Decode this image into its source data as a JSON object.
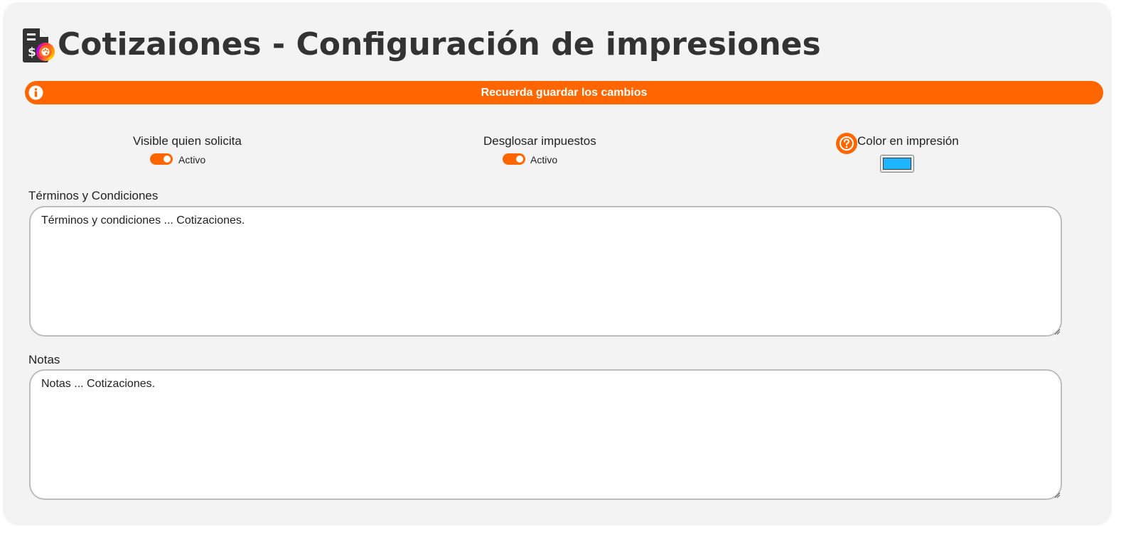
{
  "page": {
    "title": "Cotizaiones - Configuración de impresiones",
    "title_icon": "document-dollar-palette-icon"
  },
  "banner": {
    "text": "Recuerda guardar los cambios",
    "icon": "info-icon",
    "color": "#ff6600"
  },
  "options": {
    "visible_quien_solicita": {
      "label": "Visible quien solicita",
      "state": "Activo",
      "enabled": true
    },
    "desglosar_impuestos": {
      "label": "Desglosar impuestos",
      "state": "Activo",
      "enabled": true
    },
    "color_impresion": {
      "label": "Color en impresión",
      "value": "#1fb6ff",
      "help_icon": "question-circle-icon"
    }
  },
  "terminos": {
    "label": "Términos y Condiciones",
    "value": "Términos y condiciones ... Cotizaciones."
  },
  "notas": {
    "label": "Notas",
    "value": "Notas ... Cotizaciones."
  },
  "colors": {
    "accent": "#ff6600",
    "card_bg": "#f3f3f3",
    "title": "#333333"
  }
}
